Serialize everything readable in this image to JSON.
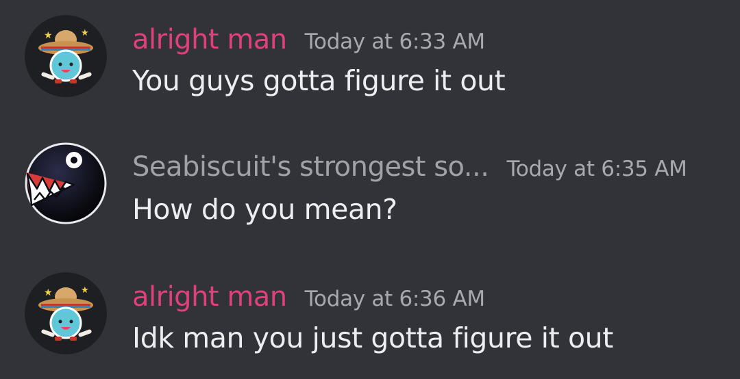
{
  "colors": {
    "background": "#313338",
    "text": "#eceef2",
    "timestamp": "#a7a9b0"
  },
  "messages": [
    {
      "author": "alright man",
      "author_color": "#e0407b",
      "avatar_icon": "sombrero-taiko-drum-avatar",
      "timestamp": "Today at 6:33 AM",
      "content": "You guys gotta figure it out"
    },
    {
      "author": "Seabiscuit's strongest so...",
      "author_color": "#9fa2a8",
      "avatar_icon": "chain-chomp-avatar",
      "timestamp": "Today at 6:35 AM",
      "content": "How do you mean?"
    },
    {
      "author": "alright man",
      "author_color": "#e0407b",
      "avatar_icon": "sombrero-taiko-drum-avatar",
      "timestamp": "Today at 6:36 AM",
      "content": "Idk man you just gotta figure it out"
    }
  ]
}
